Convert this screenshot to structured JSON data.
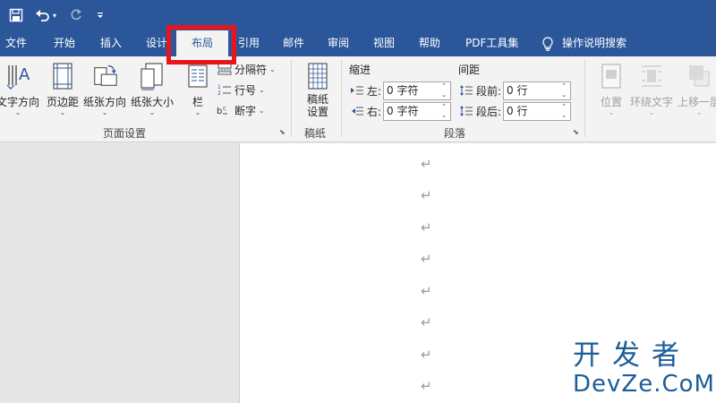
{
  "quick_access": {
    "save_icon": "save-icon",
    "undo_icon": "undo-icon",
    "redo_icon": "redo-icon",
    "customize_icon": "customize-dropdown-icon"
  },
  "tabs": [
    {
      "label": "文件"
    },
    {
      "label": "开始"
    },
    {
      "label": "插入"
    },
    {
      "label": "设计"
    },
    {
      "label": "布局",
      "active": true
    },
    {
      "label": "引用"
    },
    {
      "label": "邮件"
    },
    {
      "label": "审阅"
    },
    {
      "label": "视图"
    },
    {
      "label": "帮助"
    },
    {
      "label": "PDF工具集"
    }
  ],
  "tell_me": {
    "label": "操作说明搜索",
    "icon": "lightbulb-icon"
  },
  "page_setup": {
    "text_direction": "文字方向",
    "margins": "页边距",
    "orientation": "纸张方向",
    "size": "纸张大小",
    "columns": "栏",
    "breaks": "分隔符",
    "line_numbers": "行号",
    "hyphenation": "断字",
    "group_label": "页面设置"
  },
  "manuscript": {
    "button_line1": "稿纸",
    "button_line2": "设置",
    "group_label": "稿纸"
  },
  "paragraph": {
    "indent_heading": "缩进",
    "spacing_heading": "间距",
    "left_label": "左:",
    "right_label": "右:",
    "left_value": "0 字符",
    "right_value": "0 字符",
    "before_label": "段前:",
    "after_label": "段后:",
    "before_value": "0 行",
    "after_value": "0 行",
    "group_label": "段落"
  },
  "arrange": {
    "position": "位置",
    "wrap_text": "环绕文字",
    "bring_forward": "上移一层"
  },
  "document": {
    "paragraph_mark": "↵",
    "paragraph_count": 8
  },
  "watermark": {
    "cn": "开发者",
    "en": "DevZe.CoM"
  },
  "colors": {
    "ribbon_blue": "#2b579a",
    "highlight_red": "#e8141c",
    "watermark_blue": "#1c5d98"
  }
}
